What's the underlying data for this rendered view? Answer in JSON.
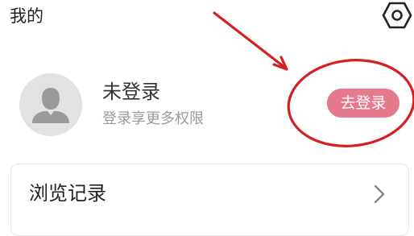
{
  "header": {
    "title": "我的",
    "settings_icon": "gear-hexagon-icon"
  },
  "profile": {
    "avatar_icon": "default-user-avatar-icon",
    "name": "未登录",
    "subtitle": "登录享更多权限",
    "login_button_label": "去登录",
    "login_button_color": "#e57a8d"
  },
  "menu": {
    "items": [
      {
        "label": "浏览记录",
        "icon": "chevron-right-icon"
      }
    ]
  },
  "annotation": {
    "color": "#d42020"
  }
}
